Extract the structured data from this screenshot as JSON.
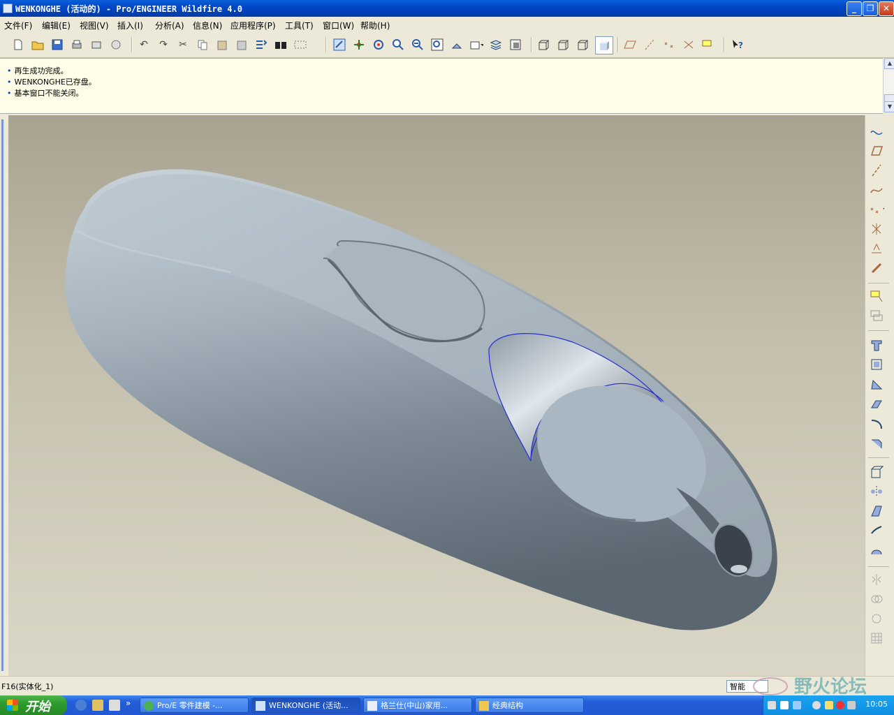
{
  "window": {
    "title": "WENKONGHE (活动的) - Pro/ENGINEER Wildfire 4.0"
  },
  "menu": [
    "文件(F)",
    "编辑(E)",
    "视图(V)",
    "插入(I)",
    "分析(A)",
    "信息(N)",
    "应用程序(P)",
    "工具(T)",
    "窗口(W)",
    "帮助(H)"
  ],
  "messages": [
    "再生成功完成。",
    "WENKONGHE已存盘。",
    "基本窗口不能关闭。"
  ],
  "status": {
    "text": "F16(实体化_1)",
    "filter": "智能"
  },
  "watermark": "野火论坛",
  "taskbar": {
    "start_label": "开始",
    "tasks": [
      "Pro/E 零件建模 -...",
      "WENKONGHE (活动...",
      "格兰仕(中山)家用...",
      "经典结构"
    ],
    "clock": "10:05"
  },
  "colors": {
    "title_blue": "#0047c8",
    "taskbar_blue": "#245ed8",
    "model_gray": "#9aa8b3"
  }
}
